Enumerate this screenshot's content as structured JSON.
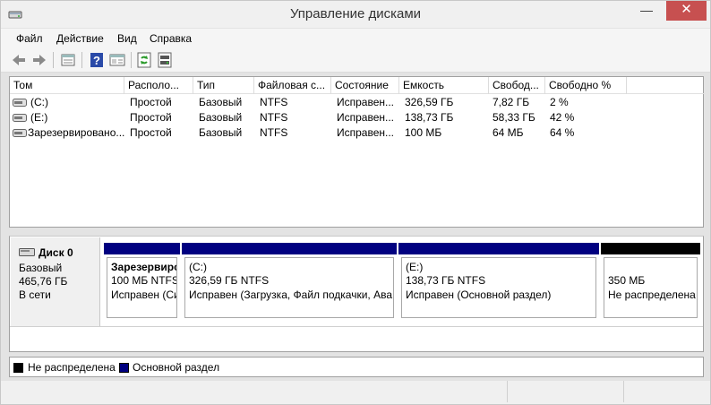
{
  "window": {
    "title": "Управление дисками",
    "controls": {
      "minimize": "—",
      "maximize": "☐",
      "close": "✕"
    }
  },
  "menu": {
    "items": [
      {
        "label": "Файл"
      },
      {
        "label": "Действие"
      },
      {
        "label": "Вид"
      },
      {
        "label": "Справка"
      }
    ]
  },
  "toolbar": {
    "buttons": [
      "back-arrow-icon",
      "forward-arrow-icon",
      "properties-list-icon",
      "help-icon",
      "console-pane-icon",
      "refresh-icon",
      "disk-settings-icon"
    ]
  },
  "volumes": {
    "columns": [
      "Том",
      "Располо...",
      "Тип",
      "Файловая с...",
      "Состояние",
      "Емкость",
      "Свобод...",
      "Свободно %"
    ],
    "rows": [
      {
        "volume": "(C:)",
        "layout": "Простой",
        "type": "Базовый",
        "fs": "NTFS",
        "status": "Исправен...",
        "capacity": "326,59 ГБ",
        "free": "7,82 ГБ",
        "free_pct": "2 %"
      },
      {
        "volume": "(E:)",
        "layout": "Простой",
        "type": "Базовый",
        "fs": "NTFS",
        "status": "Исправен...",
        "capacity": "138,73 ГБ",
        "free": "58,33 ГБ",
        "free_pct": "42 %"
      },
      {
        "volume": "Зарезервировано...",
        "layout": "Простой",
        "type": "Базовый",
        "fs": "NTFS",
        "status": "Исправен...",
        "capacity": "100 МБ",
        "free": "64 МБ",
        "free_pct": "64 %"
      }
    ]
  },
  "disk": {
    "name": "Диск 0",
    "type": "Базовый",
    "size": "465,76 ГБ",
    "state": "В сети",
    "partitions": [
      {
        "label": "Зарезервиро",
        "size": "100 МБ NTFS",
        "status": "Исправен (Си",
        "bar_color": "#000080"
      },
      {
        "label": "(C:)",
        "size": "326,59 ГБ NTFS",
        "status": "Исправен (Загрузка, Файл подкачки, Ава",
        "bar_color": "#000080"
      },
      {
        "label": "(E:)",
        "size": "138,73 ГБ NTFS",
        "status": "Исправен (Основной раздел)",
        "bar_color": "#000080"
      },
      {
        "label": "",
        "size": "350 МБ",
        "status": "Не распределена",
        "bar_color": "#000000"
      }
    ]
  },
  "legend": {
    "items": [
      {
        "label": "Не распределена",
        "color": "#000000"
      },
      {
        "label": "Основной раздел",
        "color": "#000080"
      }
    ]
  }
}
